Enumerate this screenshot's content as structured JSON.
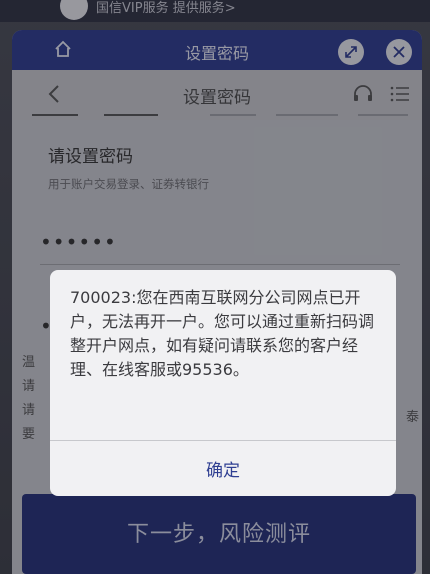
{
  "promo": {
    "text": "国信VIP服务 提供服务>"
  },
  "header": {
    "title": "设置密码"
  },
  "nav": {
    "title": "设置密码"
  },
  "form": {
    "title": "请设置密码",
    "subtitle": "用于账户交易登录、证券转银行",
    "password1": "••••••",
    "password2": "•••"
  },
  "tips": {
    "left": [
      "温",
      "请",
      "请",
      "要"
    ],
    "right": "泰"
  },
  "next_button": {
    "label": "下一步，风险测评"
  },
  "dialog": {
    "message": "700023:您在西南互联网分公司网点已开户，无法再开一户。您可以通过重新扫码调整开户网点，如有疑问请联系您的客户经理、在线客服或95536。",
    "ok_label": "确定"
  },
  "colors": {
    "primary": "#2c3a8f",
    "button": "#243078",
    "dialog_bg": "#f1f1f3"
  }
}
